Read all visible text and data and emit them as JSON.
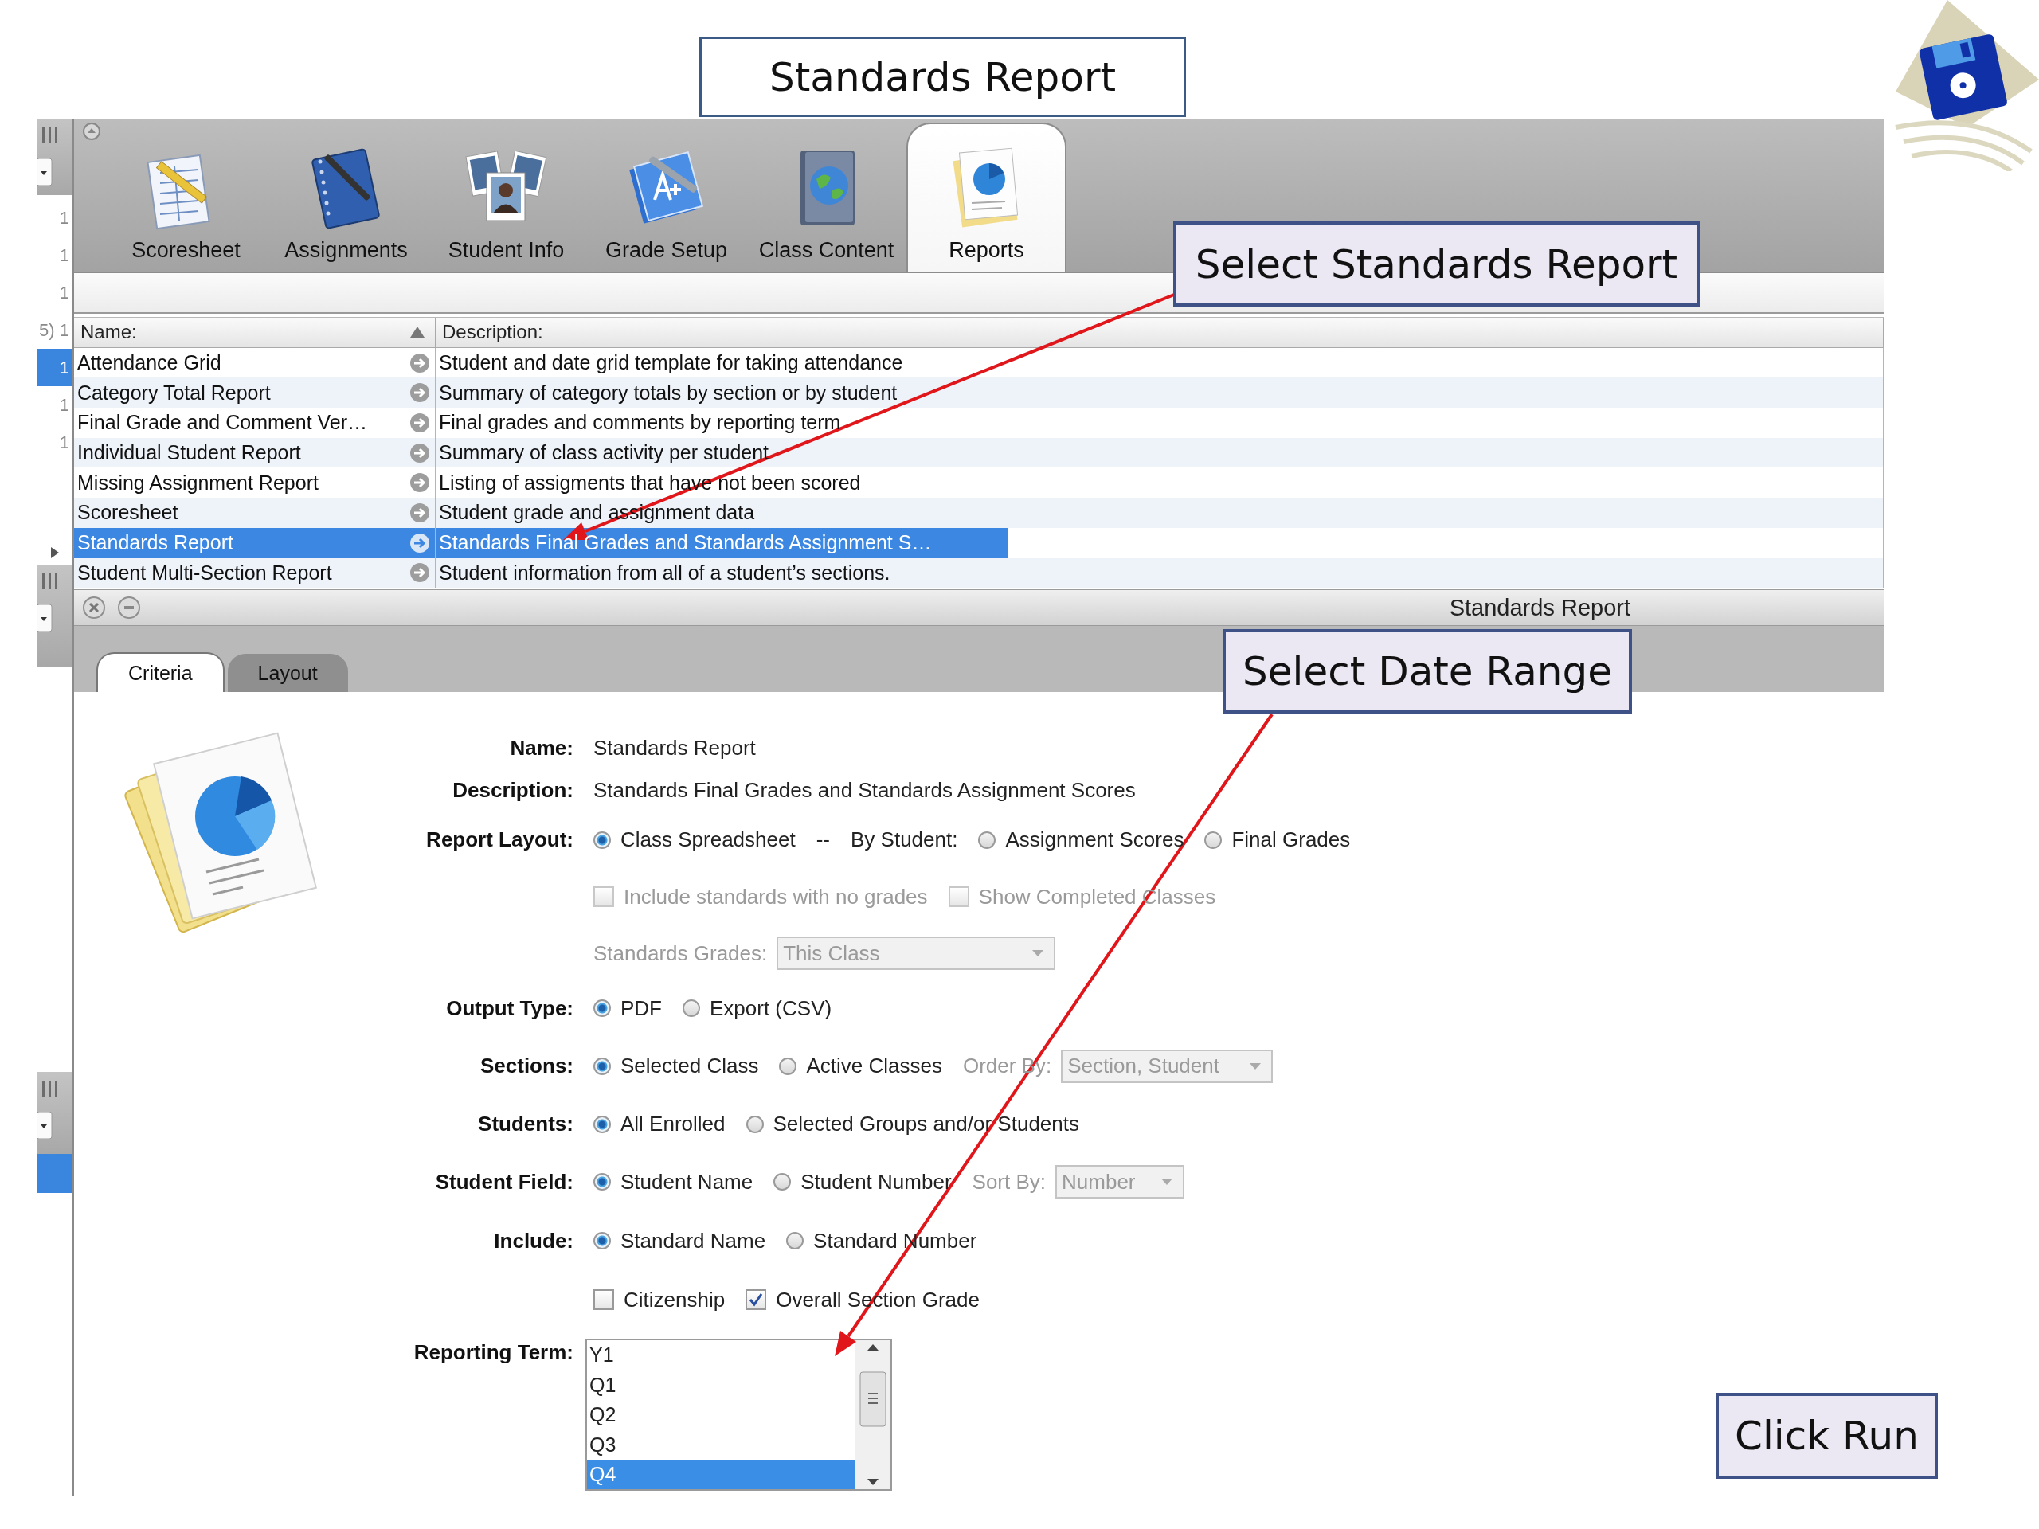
{
  "left_strip": {
    "lines": [
      {
        "text": "1",
        "selected": false
      },
      {
        "text": "1",
        "selected": false
      },
      {
        "text": "1",
        "selected": false
      },
      {
        "text": "5) 1",
        "selected": false
      },
      {
        "text": "1",
        "selected": true
      },
      {
        "text": "1",
        "selected": false
      },
      {
        "text": "1",
        "selected": false
      }
    ]
  },
  "toolbar": {
    "tabs": [
      {
        "label": "Scoresheet",
        "selected": false
      },
      {
        "label": "Assignments",
        "selected": false
      },
      {
        "label": "Student Info",
        "selected": false
      },
      {
        "label": "Grade Setup",
        "selected": false
      },
      {
        "label": "Class Content",
        "selected": false
      },
      {
        "label": "Reports",
        "selected": true
      }
    ]
  },
  "reports_table": {
    "columns": [
      {
        "label": "Name:",
        "sorted": true
      },
      {
        "label": "Description:",
        "sorted": false
      }
    ],
    "rows": [
      {
        "name": "Attendance Grid",
        "description": "Student and date grid template for taking attendance",
        "selected": false
      },
      {
        "name": "Category Total Report",
        "description": "Summary of category totals by section or by student",
        "selected": false
      },
      {
        "name": "Final Grade and Comment Ver…",
        "description": "Final grades and comments by reporting term",
        "selected": false
      },
      {
        "name": "Individual Student Report",
        "description": "Summary of class activity per student",
        "selected": false
      },
      {
        "name": "Missing Assignment Report",
        "description": "Listing of assigments that have not been scored",
        "selected": false
      },
      {
        "name": "Scoresheet",
        "description": "Student grade and assignment data",
        "selected": false
      },
      {
        "name": "Standards Report",
        "description": "Standards Final Grades and Standards Assignment S…",
        "selected": true
      },
      {
        "name": "Student Multi-Section Report",
        "description": "Student information from all of a student’s sections.",
        "selected": false
      }
    ]
  },
  "detail_panel": {
    "title": "Standards Report",
    "tabs": [
      {
        "label": "Criteria",
        "selected": true
      },
      {
        "label": "Layout",
        "selected": false
      }
    ],
    "form": {
      "rows": [
        {
          "kind": "field",
          "label": "Name:",
          "value": "Standards Report"
        },
        {
          "kind": "field",
          "label": "Description:",
          "value": "Standards Final Grades and Standards Assignment Scores"
        },
        {
          "kind": "options",
          "label": "Report Layout:",
          "items": [
            {
              "kind": "radio",
              "label": "Class Spreadsheet",
              "selected": true
            },
            {
              "kind": "text",
              "text": "--"
            },
            {
              "kind": "text",
              "text": "By Student:"
            },
            {
              "kind": "radio",
              "label": "Assignment Scores",
              "selected": false
            },
            {
              "kind": "radio",
              "label": "Final Grades",
              "selected": false
            }
          ]
        },
        {
          "kind": "options",
          "items": [
            {
              "kind": "checkbox",
              "label": "Include standards with no grades",
              "checked": false,
              "disabled": true
            },
            {
              "kind": "checkbox",
              "label": "Show Completed Classes",
              "checked": false,
              "disabled": true
            }
          ]
        },
        {
          "kind": "options",
          "items": [
            {
              "kind": "select",
              "label": "Standards Grades:",
              "value": "This Class",
              "disabled": true
            }
          ]
        },
        {
          "kind": "options",
          "label": "Output Type:",
          "items": [
            {
              "kind": "radio",
              "label": "PDF",
              "selected": true
            },
            {
              "kind": "radio",
              "label": "Export (CSV)",
              "selected": false
            }
          ]
        },
        {
          "kind": "options",
          "label": "Sections:",
          "items": [
            {
              "kind": "radio",
              "label": "Selected Class",
              "selected": true
            },
            {
              "kind": "radio",
              "label": "Active Classes",
              "selected": false
            },
            {
              "kind": "select",
              "label": "Order By:",
              "value": "Section, Student",
              "disabled": true
            }
          ]
        },
        {
          "kind": "options",
          "label": "Students:",
          "items": [
            {
              "kind": "radio",
              "label": "All Enrolled",
              "selected": true
            },
            {
              "kind": "radio",
              "label": "Selected Groups and/or Students",
              "selected": false
            }
          ]
        },
        {
          "kind": "options",
          "label": "Student Field:",
          "items": [
            {
              "kind": "radio",
              "label": "Student Name",
              "selected": true
            },
            {
              "kind": "radio",
              "label": "Student Number",
              "selected": false
            },
            {
              "kind": "select",
              "label": "Sort By:",
              "value": "Number",
              "disabled": true
            }
          ]
        },
        {
          "kind": "options",
          "label": "Include:",
          "items": [
            {
              "kind": "radio",
              "label": "Standard Name",
              "selected": true
            },
            {
              "kind": "radio",
              "label": "Standard Number",
              "selected": false
            }
          ]
        },
        {
          "kind": "options",
          "items": [
            {
              "kind": "checkbox",
              "label": "Citizenship",
              "checked": false,
              "disabled": false
            },
            {
              "kind": "checkbox",
              "label": "Overall Section Grade",
              "checked": true,
              "disabled": false
            }
          ]
        },
        {
          "kind": "listbox",
          "label": "Reporting Term:",
          "options": [
            {
              "label": "Y1",
              "selected": false
            },
            {
              "label": "Q1",
              "selected": false
            },
            {
              "label": "Q2",
              "selected": false
            },
            {
              "label": "Q3",
              "selected": false
            },
            {
              "label": "Q4",
              "selected": true
            }
          ]
        }
      ]
    }
  },
  "callouts": [
    {
      "kind": "title",
      "text": "Standards Report"
    },
    {
      "kind": "step",
      "text": "Select Standards Report"
    },
    {
      "kind": "step",
      "text": "Select Date Range"
    },
    {
      "kind": "step",
      "text": "Click Run"
    }
  ]
}
